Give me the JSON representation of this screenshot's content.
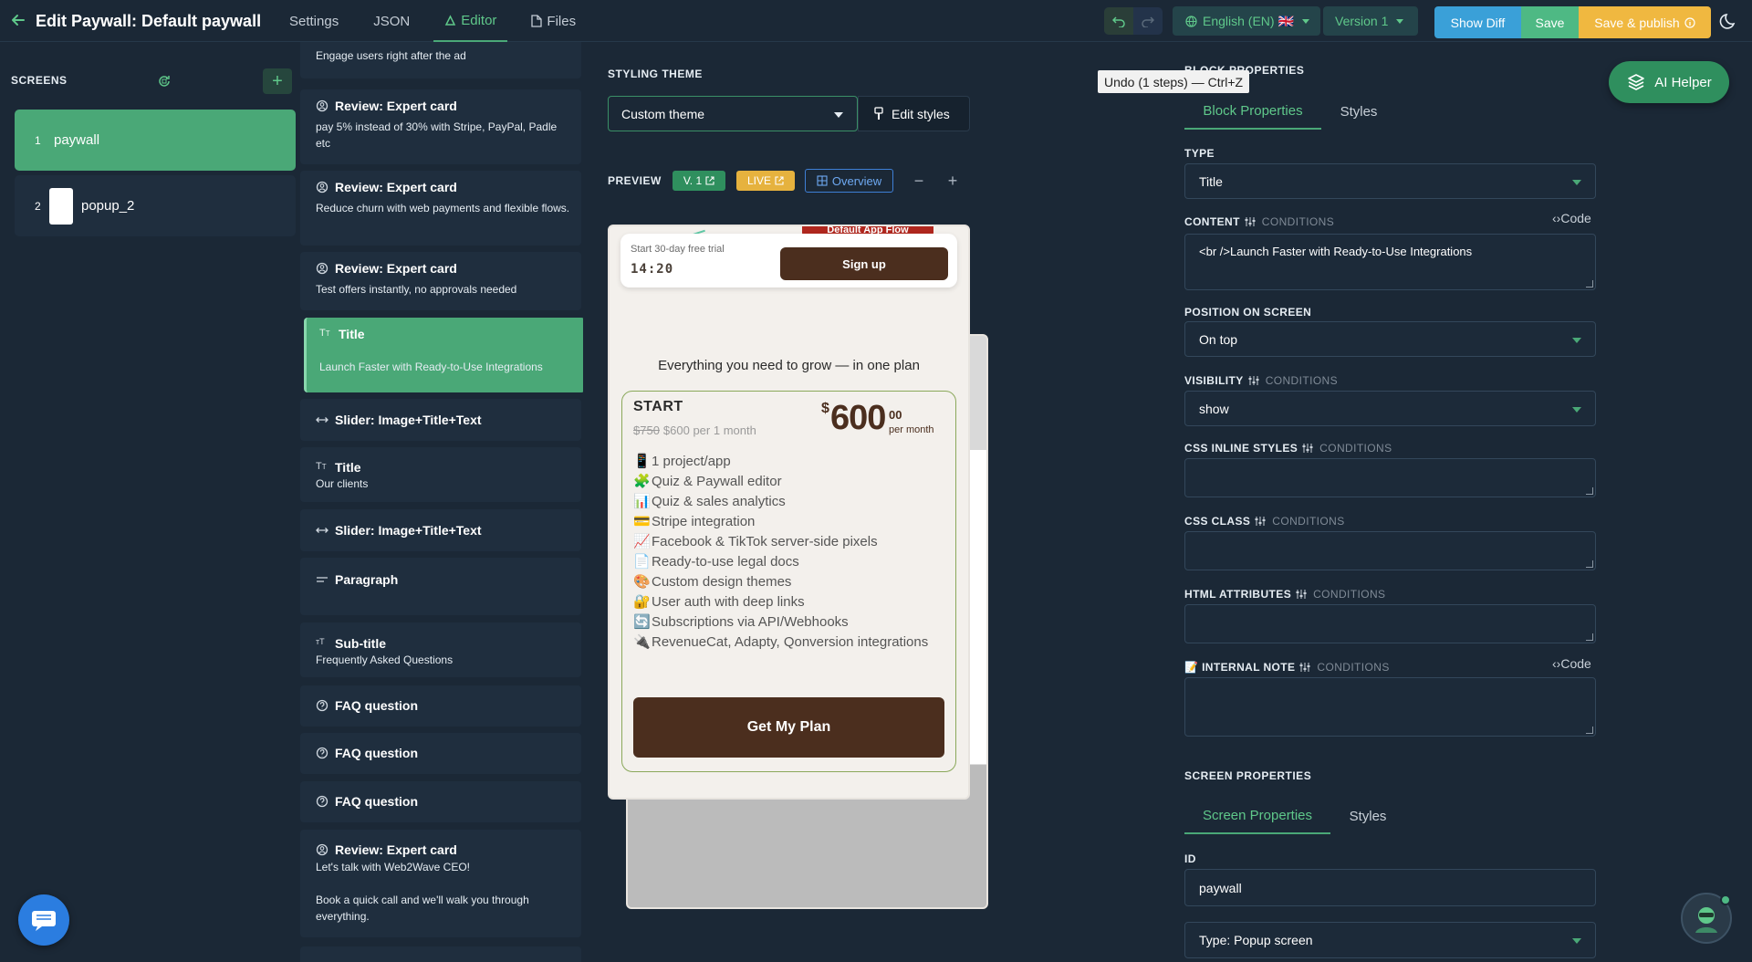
{
  "header": {
    "title": "Edit Paywall: Default paywall",
    "tabs": [
      {
        "label": "Settings"
      },
      {
        "label": "JSON"
      },
      {
        "label": "Editor"
      },
      {
        "label": "Files"
      }
    ],
    "language": "English (EN) 🇬🇧",
    "version": "Version 1",
    "show_diff": "Show Diff",
    "save": "Save",
    "save_publish": "Save & publish"
  },
  "tooltip": "Undo (1 steps) — Ctrl+Z",
  "screens": {
    "heading": "SCREENS",
    "add_label": "+",
    "items": [
      {
        "num": "1",
        "name": "paywall"
      },
      {
        "num": "2",
        "name": "popup_2"
      }
    ]
  },
  "blocks": [
    {
      "title": "",
      "desc": "Engage users right after the ad"
    },
    {
      "title": "Review: Expert card",
      "desc": "pay 5% instead of 30% with Stripe, PayPal, Padle etc"
    },
    {
      "title": "Review: Expert card",
      "desc": "Reduce churn with web payments and flexible flows."
    },
    {
      "title": "Review: Expert card",
      "desc": "Test offers instantly, no approvals needed"
    },
    {
      "title": "Title",
      "desc": "Launch Faster with Ready-to-Use Integrations"
    },
    {
      "title": "Slider: Image+Title+Text",
      "desc": ""
    },
    {
      "title": "Title",
      "desc": "Our clients"
    },
    {
      "title": "Slider: Image+Title+Text",
      "desc": ""
    },
    {
      "title": "Paragraph",
      "desc": ""
    },
    {
      "title": "Sub-title",
      "desc": "Frequently Asked Questions"
    },
    {
      "title": "FAQ question",
      "desc": ""
    },
    {
      "title": "FAQ question",
      "desc": ""
    },
    {
      "title": "FAQ question",
      "desc": ""
    },
    {
      "title": "Review: Expert card",
      "desc": "Let's talk with Web2Wave CEO!\n\nBook a quick call and we'll walk you through everything."
    }
  ],
  "styling": {
    "heading": "STYLING THEME",
    "theme": "Custom theme",
    "edit_styles": "Edit styles"
  },
  "preview": {
    "heading": "PREVIEW",
    "version_badge": "V. 1",
    "live_badge": "LIVE",
    "overview": "Overview",
    "zoom_out": "−",
    "zoom_in": "+",
    "ribbon": "Default App Flow",
    "trial_text": "Start 30-day free trial",
    "timer": "14:20",
    "signup": "Sign up",
    "grow_text": "Everything you need to grow — in one plan",
    "plan": {
      "name": "START",
      "old_price": "$750",
      "new_price": "$600 per 1 month",
      "currency": "$",
      "price": "600",
      "cents": "00",
      "per": "per month"
    },
    "features": [
      {
        "icon": "📱",
        "text": "1 project/app"
      },
      {
        "icon": "🧩",
        "text": "Quiz & Paywall editor"
      },
      {
        "icon": "📊",
        "text": "Quiz & sales analytics"
      },
      {
        "icon": "💳",
        "text": "Stripe integration"
      },
      {
        "icon": "📈",
        "text": "Facebook & TikTok server-side pixels"
      },
      {
        "icon": "📄",
        "text": "Ready-to-use legal docs"
      },
      {
        "icon": "🎨",
        "text": "Custom design themes"
      },
      {
        "icon": "🔐",
        "text": "User auth with deep links"
      },
      {
        "icon": "🔄",
        "text": "Subscriptions via API/Webhooks"
      },
      {
        "icon": "🔌",
        "text": "RevenueCat, Adapty, Qonversion integrations"
      }
    ],
    "cta": "Get My Plan"
  },
  "block_properties": {
    "heading": "BLOCK PROPERTIES",
    "tabs": [
      "Block Properties",
      "Styles"
    ],
    "type_label": "TYPE",
    "type_value": "Title",
    "content_label": "CONTENT",
    "conditions": "CONDITIONS",
    "code": "Code",
    "content_value": "<br />Launch Faster with Ready-to-Use Integrations",
    "position_label": "POSITION ON SCREEN",
    "position_value": "On top",
    "visibility_label": "VISIBILITY",
    "visibility_value": "show",
    "css_inline_label": "CSS INLINE STYLES",
    "css_class_label": "CSS CLASS",
    "html_attr_label": "HTML ATTRIBUTES",
    "internal_note_label": "📝 INTERNAL NOTE"
  },
  "screen_properties": {
    "heading": "SCREEN PROPERTIES",
    "tabs": [
      "Screen Properties",
      "Styles"
    ],
    "id_label": "ID",
    "id_value": "paywall",
    "type_value": "Type: Popup screen"
  },
  "ai_helper": "AI Helper",
  "colors": {
    "accent": "#4aa877",
    "background": "#1b2836",
    "show_diff": "#3aa0d8",
    "publish": "#f0b840",
    "brand_brown": "#4b2e1e"
  }
}
